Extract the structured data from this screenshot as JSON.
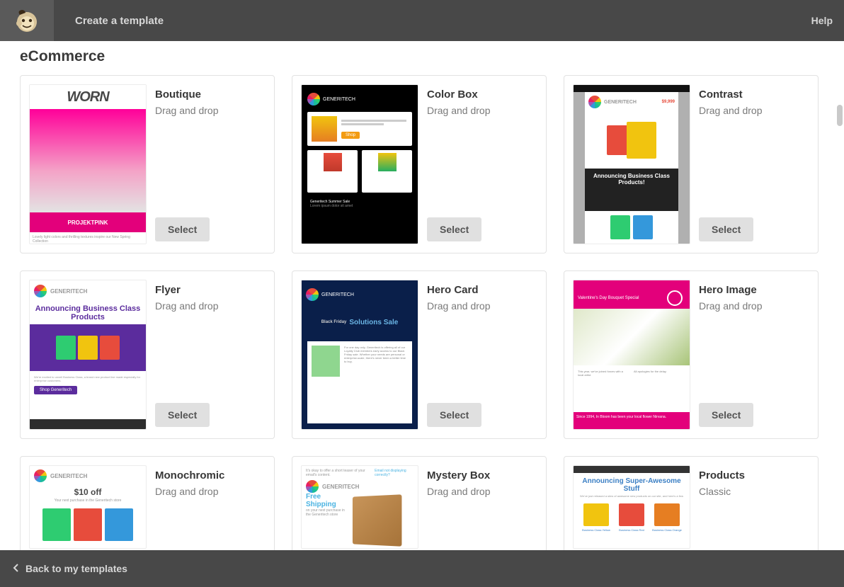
{
  "header": {
    "title": "Create a template",
    "help": "Help"
  },
  "section_title": "eCommerce",
  "select_label": "Select",
  "back_label": "Back to my templates",
  "templates": [
    {
      "name": "Boutique",
      "sub": "Drag and drop",
      "thumb": "boutique"
    },
    {
      "name": "Color Box",
      "sub": "Drag and drop",
      "thumb": "colorbox"
    },
    {
      "name": "Contrast",
      "sub": "Drag and drop",
      "thumb": "contrast"
    },
    {
      "name": "Flyer",
      "sub": "Drag and drop",
      "thumb": "flyer"
    },
    {
      "name": "Hero Card",
      "sub": "Drag and drop",
      "thumb": "herocard"
    },
    {
      "name": "Hero Image",
      "sub": "Drag and drop",
      "thumb": "heroimage"
    },
    {
      "name": "Monochromic",
      "sub": "Drag and drop",
      "thumb": "mono"
    },
    {
      "name": "Mystery Box",
      "sub": "Drag and drop",
      "thumb": "mystery"
    },
    {
      "name": "Products",
      "sub": "Classic",
      "thumb": "products"
    }
  ],
  "thumb_text": {
    "boutique_logo": "WORN",
    "boutique_banner": "PROJEKTPINK",
    "generitech": "GENERITECH",
    "contrast_headline": "Announcing Business Class Products!",
    "flyer_title": "Announcing Business Class Products",
    "herocard_title": "Solutions Sale",
    "herocard_pre": "Black Friday",
    "heroimage_title": "Valentine's Day Bouquet Special",
    "mono_ten": "$10 off",
    "mystery_ship": "Free Shipping",
    "products_title": "Announcing Super-Awesome Stuff"
  }
}
